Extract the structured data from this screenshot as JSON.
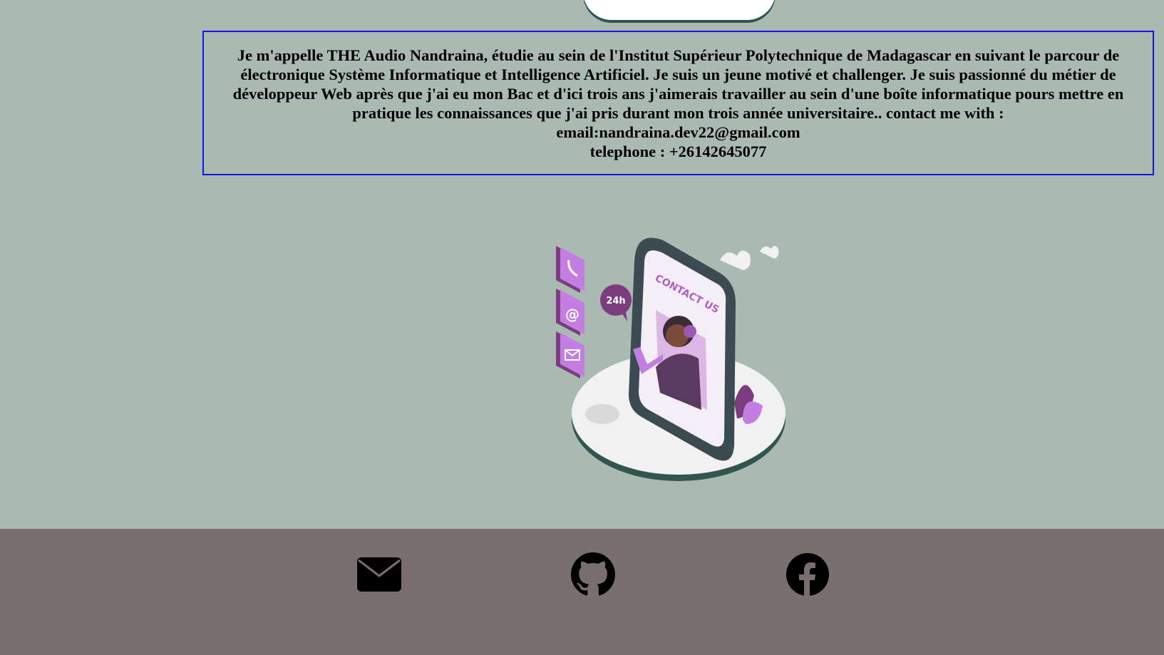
{
  "about": {
    "paragraph": "Je m'appelle THE Audio Nandraina, étudie au sein de l'Institut Supérieur Polytechnique de Madagascar en suivant le parcour de électronique Système Informatique et Intelligence Artificiel. Je suis un jeune motivé et challenger. Je suis passionné du métier de développeur Web après que j'ai eu mon Bac et d'ici trois ans j'aimerais travailler au sein d'une boîte informatique pours mettre en pratique les connaissances que j'ai pris durant mon trois année universitaire.. contact me with :",
    "email": "email:nandraina.dev22@gmail.com",
    "phone": "telephone : +26142645077"
  },
  "illustration": {
    "screen_text": "CONTACT US",
    "badge": "24h",
    "icons": [
      "phone-icon",
      "at-icon",
      "envelope-icon"
    ]
  },
  "footer": {
    "links": [
      "envelope-icon",
      "github-icon",
      "facebook-icon"
    ]
  },
  "colors": {
    "background": "#aabab2",
    "footer": "#7a6e6f",
    "box_border": "#1414e6",
    "accent_purple": "#b25fc7"
  }
}
